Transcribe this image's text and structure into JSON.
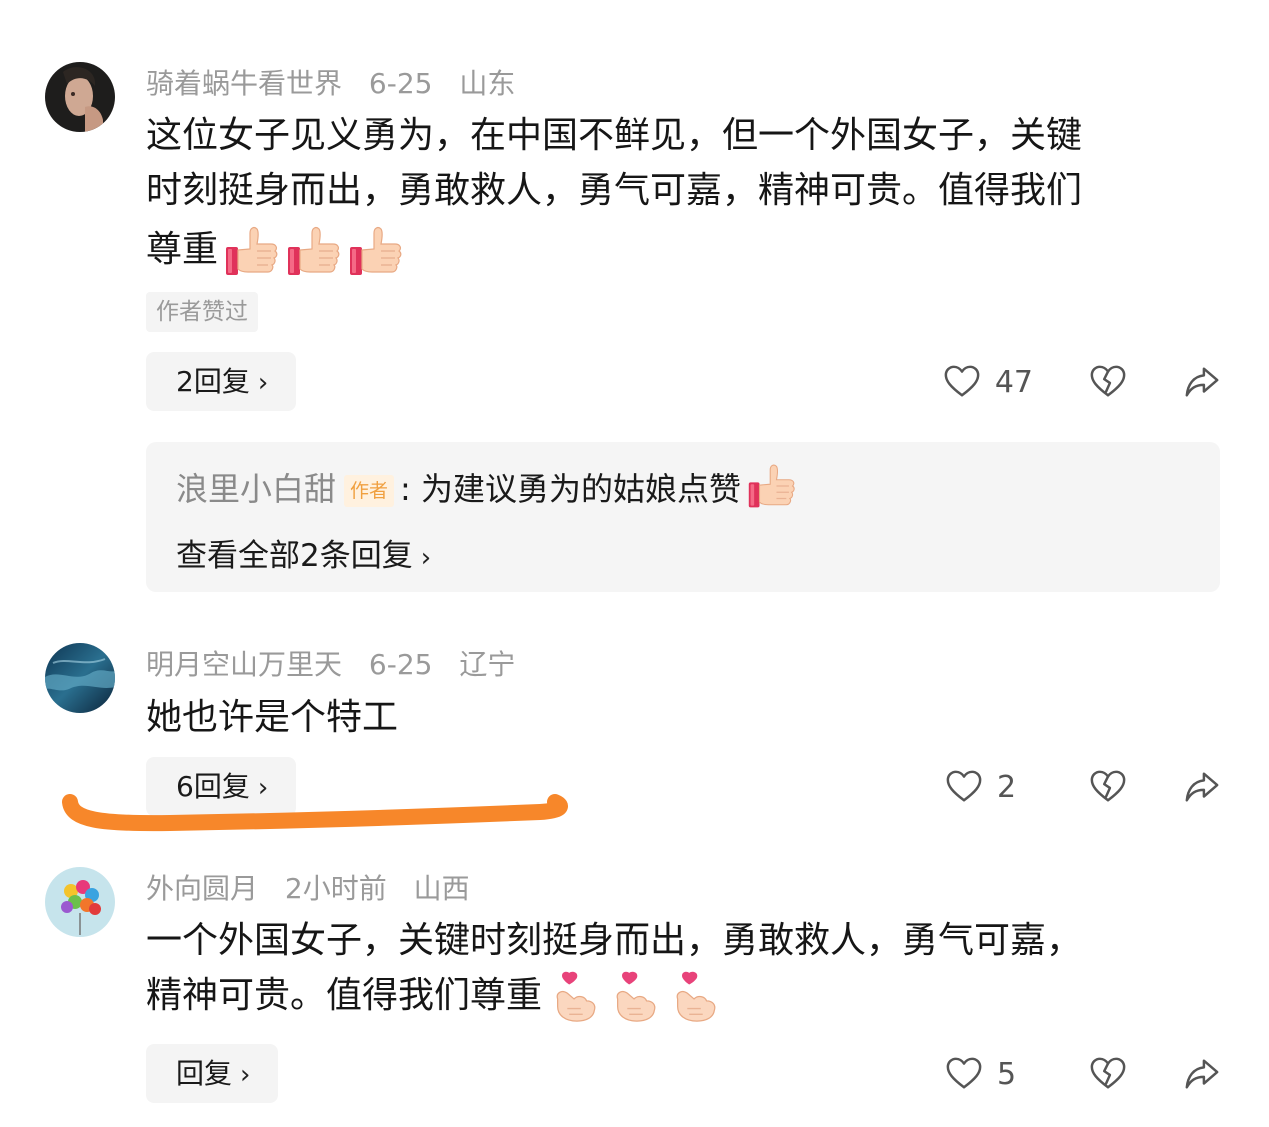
{
  "comments": [
    {
      "username": "骑着蜗牛看世界",
      "date": "6-25",
      "location": "山东",
      "text_line1": "这位女子见义勇为，在中国不鲜见，但一个外国女子，关键",
      "text_line2": "时刻挺身而出，勇敢救人，勇气可嘉，精神可贵。值得我们",
      "text_line3": "尊重",
      "emojis": [
        "thumbs-up",
        "thumbs-up",
        "thumbs-up"
      ],
      "tag": "作者赞过",
      "reply_label": "2回复",
      "like_count": "47"
    },
    {
      "username": "明月空山万里天",
      "date": "6-25",
      "location": "辽宁",
      "text_line1": "她也许是个特工",
      "reply_label": "6回复",
      "like_count": "2"
    },
    {
      "username": "外向圆月",
      "date": "2小时前",
      "location": "山西",
      "text_line1": "一个外国女子，关键时刻挺身而出，勇敢救人，勇气可嘉，",
      "text_line2": "精神可贵。值得我们尊重",
      "emojis": [
        "finger-heart",
        "finger-heart",
        "finger-heart"
      ],
      "reply_label": "回复",
      "like_count": "5"
    }
  ],
  "sub_reply": {
    "username": "浪里小白甜",
    "badge": "作者",
    "separator": ":",
    "text": "为建议勇为的姑娘点赞",
    "view_all": "查看全部2条回复"
  },
  "icons": {
    "like": "heart-icon",
    "dislike": "broken-heart-icon",
    "share": "share-arrow-icon",
    "chevron": "chevron-right-icon"
  },
  "colors": {
    "annotation_stroke": "#f7872a",
    "author_badge_text": "#f0a040",
    "author_badge_bg": "#fff1df"
  }
}
